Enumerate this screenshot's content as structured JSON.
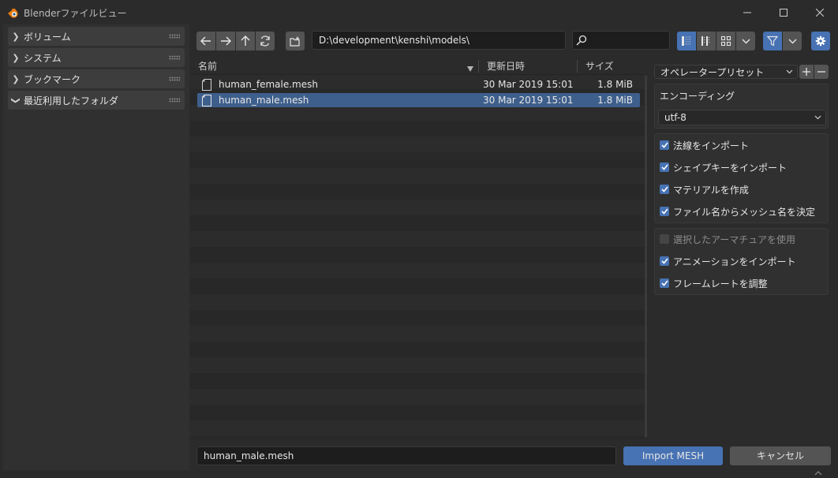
{
  "window": {
    "title": "Blenderファイルビュー"
  },
  "sidebar": {
    "panels": [
      {
        "label": "ボリューム",
        "expanded": false
      },
      {
        "label": "システム",
        "expanded": false
      },
      {
        "label": "ブックマーク",
        "expanded": false
      },
      {
        "label": "最近利用したフォルダ",
        "expanded": true
      }
    ]
  },
  "toolbar": {
    "path": "D:\\development\\kenshi\\models\\",
    "search_value": "",
    "icons": [
      "arrow-left-icon",
      "arrow-right-icon",
      "parent-folder-icon",
      "refresh-icon",
      "new-folder-icon",
      "search-icon",
      "view-vertical-list-icon",
      "view-horizontal-list-icon",
      "view-thumbnails-icon",
      "filter-icon",
      "gear-icon"
    ]
  },
  "file_list": {
    "columns": {
      "name": "名前",
      "date": "更新日時",
      "size": "サイズ"
    },
    "rows": [
      {
        "name": "human_female.mesh",
        "date": "30 Mar 2019 15:01",
        "size": "1.8 MiB",
        "selected": false
      },
      {
        "name": "human_male.mesh",
        "date": "30 Mar 2019 15:01",
        "size": "1.8 MiB",
        "selected": true
      }
    ]
  },
  "options": {
    "preset": "オペレータープリセット",
    "encoding_label": "エンコーディング",
    "encoding_value": "utf-8",
    "group1": [
      {
        "label": "法線をインポート",
        "checked": true,
        "disabled": false
      },
      {
        "label": "シェイプキーをインポート",
        "checked": true,
        "disabled": false
      },
      {
        "label": "マテリアルを作成",
        "checked": true,
        "disabled": false
      },
      {
        "label": "ファイル名からメッシュ名を決定",
        "checked": true,
        "disabled": false
      }
    ],
    "group2": [
      {
        "label": "選択したアーマチュアを使用",
        "checked": false,
        "disabled": true
      },
      {
        "label": "アニメーションをインポート",
        "checked": true,
        "disabled": false
      },
      {
        "label": "フレームレートを調整",
        "checked": true,
        "disabled": false
      }
    ]
  },
  "bottom": {
    "filename": "human_male.mesh",
    "import_label": "Import MESH",
    "cancel_label": "キャンセル"
  },
  "colors": {
    "accent": "#4772b3",
    "selection": "#3e5f8c",
    "background": "#2b2b2b"
  }
}
